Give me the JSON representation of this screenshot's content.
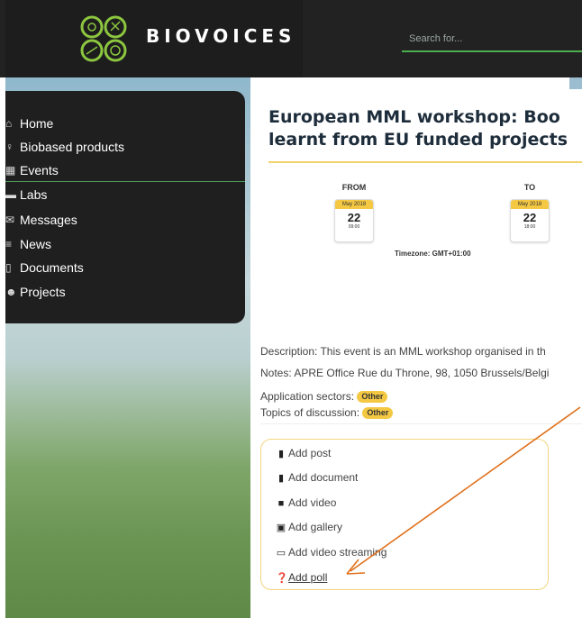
{
  "header": {
    "brand": "BIOVOICES",
    "search_placeholder": "Search for..."
  },
  "sidebar": {
    "items": [
      {
        "label": "Home",
        "icon": "home-icon"
      },
      {
        "label": "Biobased products",
        "icon": "lightbulb-icon"
      },
      {
        "label": "Events",
        "icon": "calendar-icon"
      },
      {
        "label": "Labs",
        "icon": "briefcase-icon"
      },
      {
        "label": "Messages",
        "icon": "envelope-icon"
      },
      {
        "label": "News",
        "icon": "newspaper-icon"
      },
      {
        "label": "Documents",
        "icon": "document-icon"
      },
      {
        "label": "Projects",
        "icon": "users-icon"
      }
    ]
  },
  "event": {
    "title_line1": "European MML workshop: Boo",
    "title_line2": "learnt from EU funded projects",
    "from_label": "FROM",
    "to_label": "TO",
    "from": {
      "month": "May 2018",
      "day": "22",
      "time": "09:00"
    },
    "to": {
      "month": "May 2018",
      "day": "22",
      "time": "18:00"
    },
    "timezone": "Timezone: GMT+01:00",
    "description": "Description: This event is an MML workshop organised in th",
    "notes": "Notes: APRE Office Rue du Throne, 98, 1050 Brussels/Belgi",
    "application_sectors_label": "Application sectors:",
    "application_sectors_tag": "Other",
    "topics_label": "Topics of discussion:",
    "topics_tag": "Other"
  },
  "actions": {
    "add_post": "Add post",
    "add_document": "Add document",
    "add_video": "Add video",
    "add_gallery": "Add gallery",
    "add_video_streaming": "Add video streaming",
    "add_poll": "Add poll"
  },
  "colors": {
    "accent_green": "#4caf50",
    "accent_yellow": "#f4c842",
    "arrow_orange": "#e0701a"
  }
}
